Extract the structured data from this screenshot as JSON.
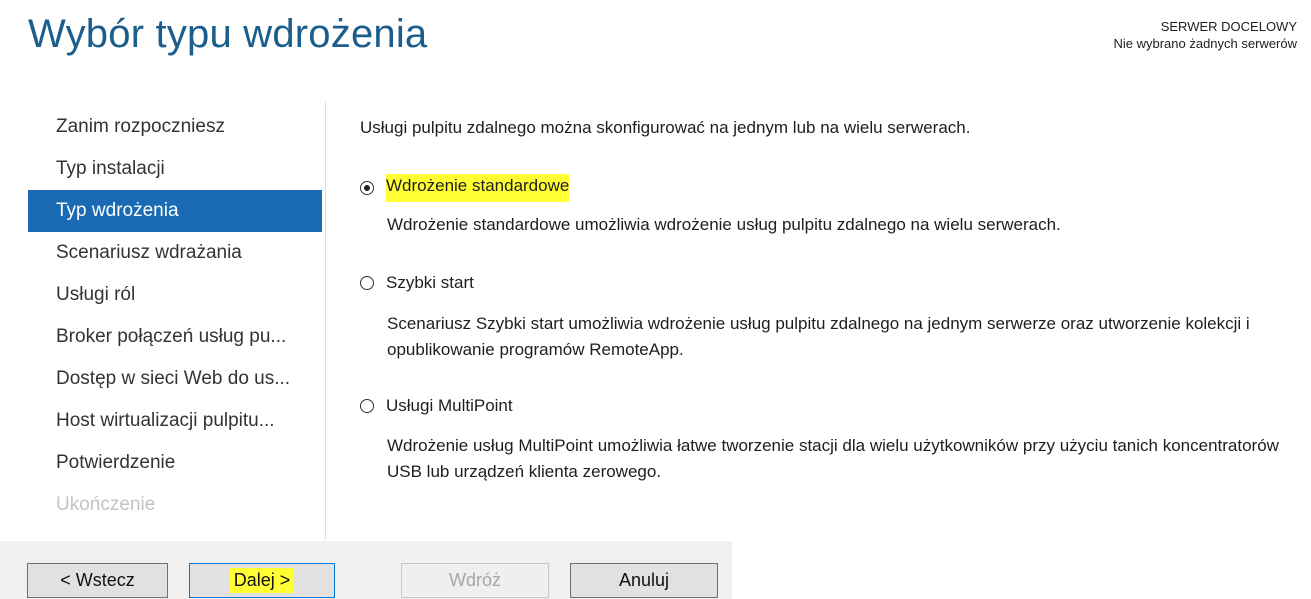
{
  "header": {
    "title": "Wybór typu wdrożenia",
    "target_label": "SERWER DOCELOWY",
    "target_value": "Nie wybrano żadnych serwerów"
  },
  "nav": {
    "items": [
      {
        "label": "Zanim rozpoczniesz",
        "state": "normal"
      },
      {
        "label": "Typ instalacji",
        "state": "normal"
      },
      {
        "label": "Typ wdrożenia",
        "state": "active"
      },
      {
        "label": "Scenariusz wdrażania",
        "state": "normal"
      },
      {
        "label": "Usługi ról",
        "state": "normal"
      },
      {
        "label": "Broker połączeń usług pu...",
        "state": "normal"
      },
      {
        "label": "Dostęp w sieci Web do us...",
        "state": "normal"
      },
      {
        "label": "Host wirtualizacji pulpitu...",
        "state": "normal"
      },
      {
        "label": "Potwierdzenie",
        "state": "normal"
      },
      {
        "label": "Ukończenie",
        "state": "disabled"
      }
    ]
  },
  "main": {
    "intro": "Usługi pulpitu zdalnego można skonfigurować na jednym lub na wielu serwerach.",
    "options": [
      {
        "label": "Wdrożenie standardowe",
        "selected": true,
        "highlighted": true,
        "description": "Wdrożenie standardowe umożliwia wdrożenie usług pulpitu zdalnego na wielu serwerach."
      },
      {
        "label": "Szybki start",
        "selected": false,
        "description": "Scenariusz Szybki start umożliwia wdrożenie usług pulpitu zdalnego na jednym serwerze oraz utworzenie kolekcji i opublikowanie programów RemoteApp."
      },
      {
        "label": "Usługi MultiPoint",
        "selected": false,
        "description": "Wdrożenie usług MultiPoint umożliwia łatwe tworzenie stacji dla wielu użytkowników przy użyciu tanich koncentratorów USB lub urządzeń klienta zerowego."
      }
    ]
  },
  "footer": {
    "back_label": "< Wstecz",
    "next_label": "Dalej >",
    "deploy_label": "Wdróż",
    "cancel_label": "Anuluj"
  },
  "colors": {
    "accent": "#1a6bb3",
    "title": "#1b5e8c",
    "highlight": "#ffff33"
  }
}
